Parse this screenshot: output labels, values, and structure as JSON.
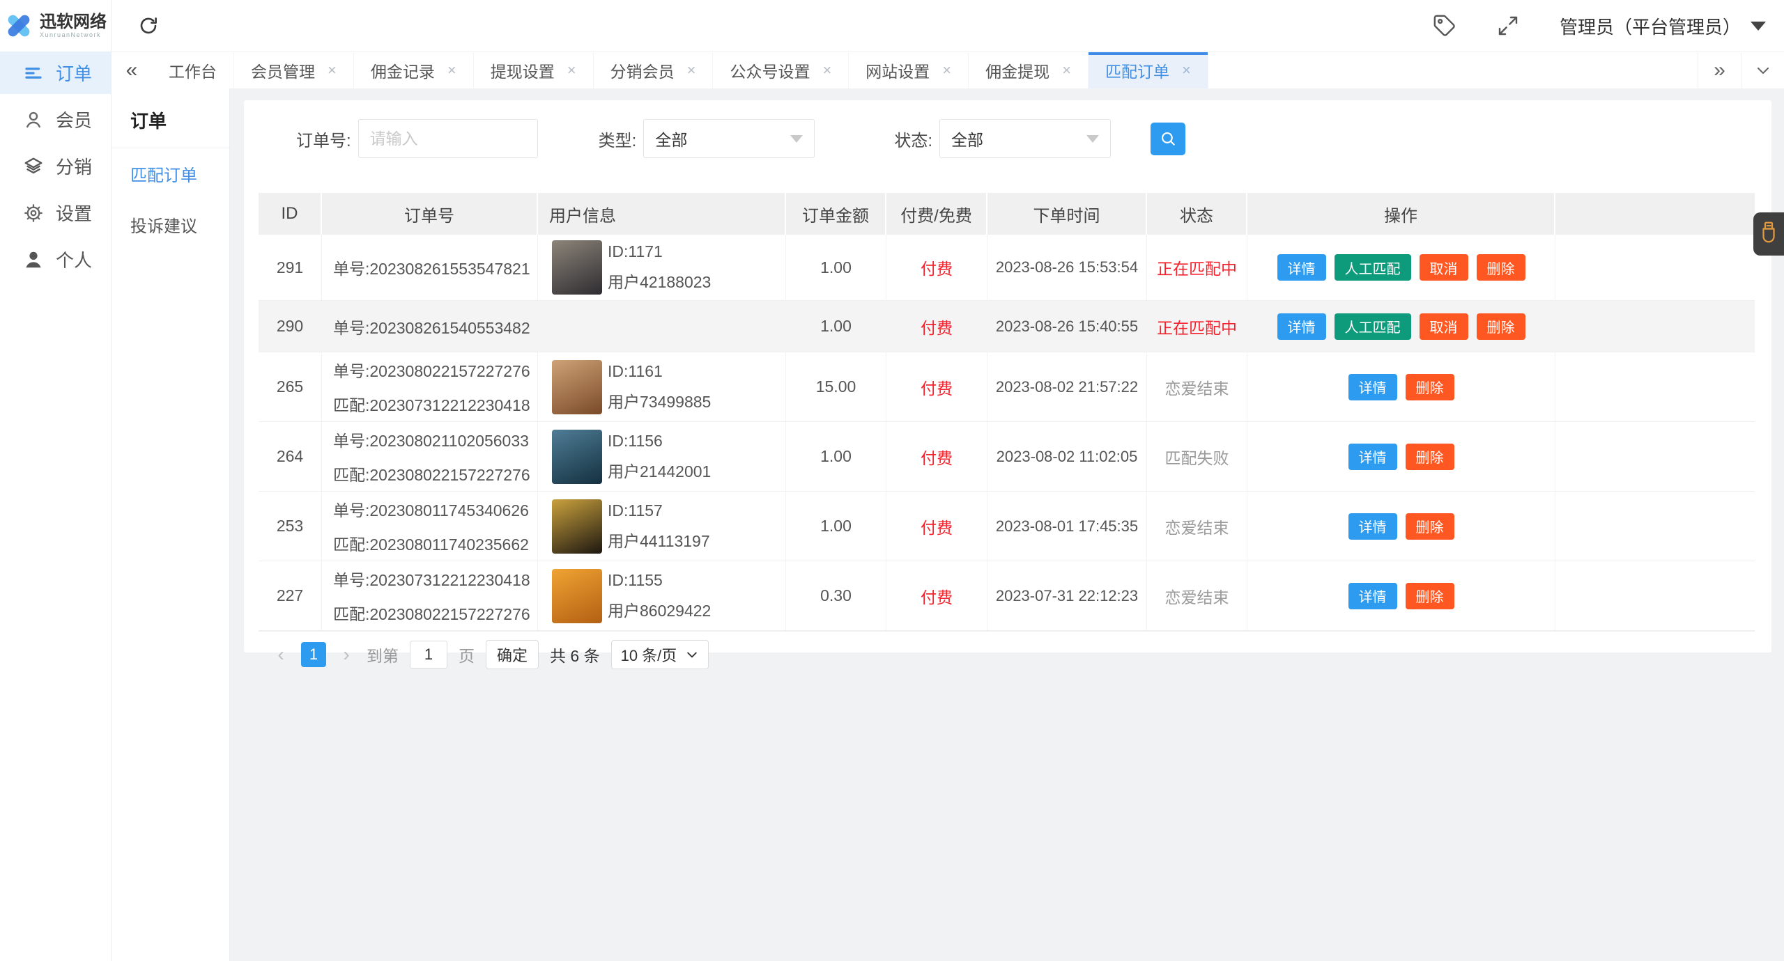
{
  "topbar": {
    "logo": {
      "text": "迅软网络",
      "subtext": "XunruanNetwork",
      "icon": "x-logo-icon"
    },
    "refresh_icon": "refresh-icon",
    "tag_icon": "tag-icon",
    "fullscreen_icon": "fullscreen-icon",
    "user_label": "管理员（平台管理员）"
  },
  "sidebar": {
    "items": [
      {
        "label": "订单",
        "icon": "order-list-icon",
        "active": true
      },
      {
        "label": "会员",
        "icon": "member-icon",
        "active": false
      },
      {
        "label": "分销",
        "icon": "distribution-layers-icon",
        "active": false
      },
      {
        "label": "设置",
        "icon": "settings-gear-icon",
        "active": false
      },
      {
        "label": "个人",
        "icon": "profile-person-icon",
        "active": false
      }
    ]
  },
  "tabbar": {
    "collapse_icon": "collapse-tabs-icon",
    "overflow_icon": "more-tabs-icon",
    "dropdown_icon": "tabs-dropdown-icon",
    "tabs": [
      {
        "label": "工作台",
        "closable": false,
        "active": false
      },
      {
        "label": "会员管理",
        "closable": true,
        "active": false
      },
      {
        "label": "佣金记录",
        "closable": true,
        "active": false
      },
      {
        "label": "提现设置",
        "closable": true,
        "active": false
      },
      {
        "label": "分销会员",
        "closable": true,
        "active": false
      },
      {
        "label": "公众号设置",
        "closable": true,
        "active": false
      },
      {
        "label": "网站设置",
        "closable": true,
        "active": false
      },
      {
        "label": "佣金提现",
        "closable": true,
        "active": false
      },
      {
        "label": "匹配订单",
        "closable": true,
        "active": true
      }
    ]
  },
  "submenu": {
    "title": "订单",
    "items": [
      {
        "label": "匹配订单",
        "active": true
      },
      {
        "label": "投诉建议",
        "active": false
      }
    ]
  },
  "filters": {
    "order_no": {
      "label": "订单号:",
      "placeholder": "请输入",
      "value": ""
    },
    "type": {
      "label": "类型:",
      "value": "全部"
    },
    "status": {
      "label": "状态:",
      "value": "全部"
    },
    "search_icon": "search-icon"
  },
  "table": {
    "columns": [
      "ID",
      "订单号",
      "用户信息",
      "订单金额",
      "付费/免费",
      "下单时间",
      "状态",
      "操作"
    ],
    "rows": [
      {
        "id": "291",
        "order_lines": [
          "单号:202308261553547821"
        ],
        "user": {
          "uid": "ID:1171",
          "name": "用户42188023",
          "avatar_colors": [
            "#8d8579",
            "#2e2c31"
          ]
        },
        "amount": "1.00",
        "fee": "付费",
        "time": "2023-08-26 15:53:54",
        "status": {
          "text": "正在匹配中",
          "tone": "red"
        },
        "actions": [
          {
            "key": "detail",
            "label": "详情",
            "tone": "blue"
          },
          {
            "key": "manual-match",
            "label": "人工匹配",
            "tone": "green"
          },
          {
            "key": "cancel",
            "label": "取消",
            "tone": "orange"
          },
          {
            "key": "delete",
            "label": "删除",
            "tone": "orange"
          }
        ],
        "highlight": false
      },
      {
        "id": "290",
        "order_lines": [
          "单号:202308261540553482"
        ],
        "user": null,
        "amount": "1.00",
        "fee": "付费",
        "time": "2023-08-26 15:40:55",
        "status": {
          "text": "正在匹配中",
          "tone": "red"
        },
        "actions": [
          {
            "key": "detail",
            "label": "详情",
            "tone": "blue"
          },
          {
            "key": "manual-match",
            "label": "人工匹配",
            "tone": "green"
          },
          {
            "key": "cancel",
            "label": "取消",
            "tone": "orange"
          },
          {
            "key": "delete",
            "label": "删除",
            "tone": "orange"
          }
        ],
        "highlight": true
      },
      {
        "id": "265",
        "order_lines": [
          "单号:202308022157227276",
          "匹配:202307312212230418"
        ],
        "user": {
          "uid": "ID:1161",
          "name": "用户73499885",
          "avatar_colors": [
            "#cfa277",
            "#7a4a28"
          ]
        },
        "amount": "15.00",
        "fee": "付费",
        "time": "2023-08-02 21:57:22",
        "status": {
          "text": "恋爱结束",
          "tone": "gray"
        },
        "actions": [
          {
            "key": "detail",
            "label": "详情",
            "tone": "blue"
          },
          {
            "key": "delete",
            "label": "删除",
            "tone": "orange"
          }
        ],
        "highlight": false
      },
      {
        "id": "264",
        "order_lines": [
          "单号:202308021102056033",
          "匹配:202308022157227276"
        ],
        "user": {
          "uid": "ID:1156",
          "name": "用户21442001",
          "avatar_colors": [
            "#4f7d96",
            "#14303f"
          ]
        },
        "amount": "1.00",
        "fee": "付费",
        "time": "2023-08-02 11:02:05",
        "status": {
          "text": "匹配失败",
          "tone": "gray"
        },
        "actions": [
          {
            "key": "detail",
            "label": "详情",
            "tone": "blue"
          },
          {
            "key": "delete",
            "label": "删除",
            "tone": "orange"
          }
        ],
        "highlight": false
      },
      {
        "id": "253",
        "order_lines": [
          "单号:202308011745340626",
          "匹配:202308011740235662"
        ],
        "user": {
          "uid": "ID:1157",
          "name": "用户44113197",
          "avatar_colors": [
            "#caa23d",
            "#1d1711"
          ]
        },
        "amount": "1.00",
        "fee": "付费",
        "time": "2023-08-01 17:45:35",
        "status": {
          "text": "恋爱结束",
          "tone": "gray"
        },
        "actions": [
          {
            "key": "detail",
            "label": "详情",
            "tone": "blue"
          },
          {
            "key": "delete",
            "label": "删除",
            "tone": "orange"
          }
        ],
        "highlight": false
      },
      {
        "id": "227",
        "order_lines": [
          "单号:202307312212230418",
          "匹配:202308022157227276"
        ],
        "user": {
          "uid": "ID:1155",
          "name": "用户86029422",
          "avatar_colors": [
            "#f0a432",
            "#b35f13"
          ]
        },
        "amount": "0.30",
        "fee": "付费",
        "time": "2023-07-31 22:12:23",
        "status": {
          "text": "恋爱结束",
          "tone": "gray"
        },
        "actions": [
          {
            "key": "detail",
            "label": "详情",
            "tone": "blue"
          },
          {
            "key": "delete",
            "label": "删除",
            "tone": "orange"
          }
        ],
        "highlight": false
      }
    ]
  },
  "pagination": {
    "prev": "‹",
    "page": "1",
    "next": "›",
    "goto_label": "到第",
    "goto_value": "1",
    "goto_unit": "页",
    "confirm": "确定",
    "total": "共 6 条",
    "per_page": "10 条/页"
  },
  "floating_widget": {
    "icon": "usb-drive-icon"
  },
  "colors": {
    "accent_blue": "#4190E4",
    "button_blue": "#2D9CF0",
    "button_green": "#0E9B7B",
    "button_orange": "#FF5722",
    "status_red": "#F5222D",
    "status_gray": "#9A9A9A"
  }
}
